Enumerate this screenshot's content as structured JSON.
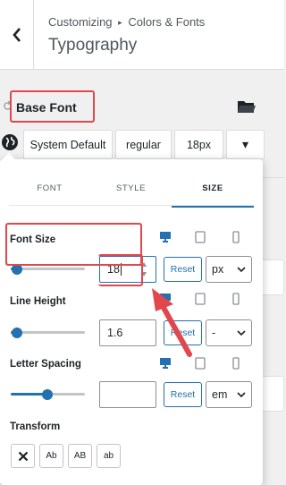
{
  "header": {
    "breadcrumb": "Customizing",
    "breadcrumb_sep": "▸",
    "breadcrumb_section": "Colors & Fonts",
    "title": "Typography"
  },
  "base_font": {
    "label": "Base Font",
    "family": "System Default",
    "weight": "regular",
    "size": "18px",
    "dropdown_glyph": "▾"
  },
  "tabs": [
    {
      "label": "FONT",
      "active": false
    },
    {
      "label": "STYLE",
      "active": false
    },
    {
      "label": "SIZE",
      "active": true
    }
  ],
  "font_size": {
    "label": "Font Size",
    "value": "18",
    "slider_level": 0.1,
    "reset_label": "Reset",
    "unit": "px"
  },
  "line_height": {
    "label": "Line Height",
    "value": "1.6",
    "slider_level": 0.1,
    "reset_label": "Reset",
    "unit": "-"
  },
  "letter_spacing": {
    "label": "Letter Spacing",
    "value": "",
    "slider_level": 0.5,
    "reset_label": "Reset",
    "unit": "em"
  },
  "transform": {
    "label": "Transform",
    "options": [
      "Ab",
      "AB",
      "ab"
    ]
  },
  "colors": {
    "accent": "#2271b1",
    "highlight": "#e2474b"
  }
}
